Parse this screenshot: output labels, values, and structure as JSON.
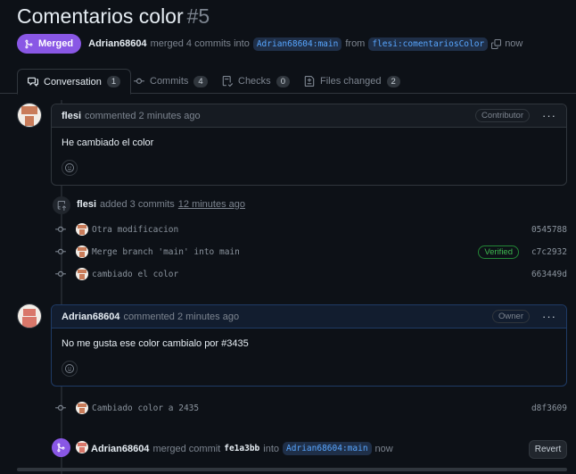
{
  "pr": {
    "title": "Comentarios color",
    "number": "#5",
    "state_label": "Merged",
    "author": "Adrian68604",
    "merge_text": "merged 4 commits into",
    "base_branch": "Adrian68604:main",
    "from_text": "from",
    "head_branch": "flesi:comentariosColor",
    "time": "now"
  },
  "tabs": [
    {
      "label": "Conversation",
      "count": "1",
      "icon": "conversation-icon"
    },
    {
      "label": "Commits",
      "count": "4",
      "icon": "commit-icon"
    },
    {
      "label": "Checks",
      "count": "0",
      "icon": "checks-icon"
    },
    {
      "label": "Files changed",
      "count": "2",
      "icon": "file-diff-icon"
    }
  ],
  "comments": [
    {
      "author": "flesi",
      "meta": "commented 2 minutes ago",
      "role": "Contributor",
      "body": "He cambiado el color"
    },
    {
      "author": "Adrian68604",
      "meta": "commented 2 minutes ago",
      "role": "Owner",
      "body": "No me gusta ese color cambialo por #3435"
    }
  ],
  "commit_event": {
    "author": "flesi",
    "text": "added 3 commits",
    "time": "12 minutes ago"
  },
  "commits": [
    {
      "message": "Otra modificacion",
      "sha": "0545788",
      "verified": ""
    },
    {
      "message": "Merge branch 'main' into main",
      "sha": "c7c2932",
      "verified": "Verified"
    },
    {
      "message": "cambiado el color",
      "sha": "663449d",
      "verified": ""
    },
    {
      "message": "Cambiado color a 2435",
      "sha": "d8f3609",
      "verified": ""
    }
  ],
  "merge_event": {
    "author": "Adrian68604",
    "text": "merged commit",
    "sha": "fe1a3bb",
    "into": "into",
    "branch": "Adrian68604:main",
    "time": "now",
    "revert_label": "Revert"
  },
  "colors": {
    "merged": "#8957e5",
    "link": "#58a6ff",
    "verified": "#3fb950",
    "background": "#0d1117"
  }
}
